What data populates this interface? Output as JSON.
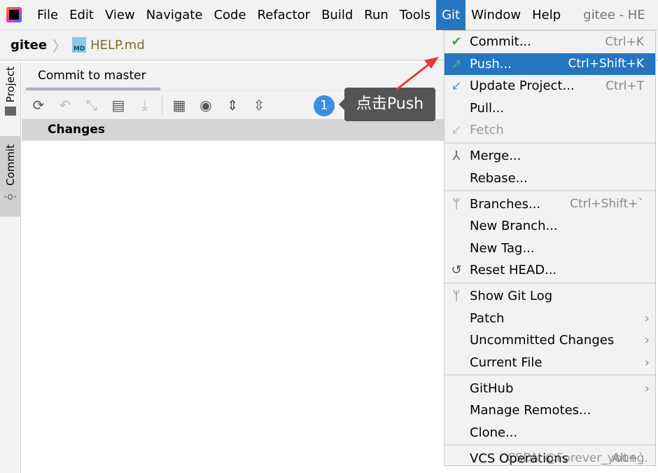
{
  "menubar": {
    "items": [
      "File",
      "Edit",
      "View",
      "Navigate",
      "Code",
      "Refactor",
      "Build",
      "Run",
      "Tools",
      "Git",
      "Window",
      "Help"
    ],
    "active": "Git",
    "title": "gitee - HE"
  },
  "breadcrumb": {
    "project": "gitee",
    "file": "HELP.md",
    "file_icon_label": "MD"
  },
  "left_strip": {
    "tabs": [
      "Project",
      "Commit"
    ]
  },
  "tool_window": {
    "tab": "Commit to master",
    "changes_header": "Changes",
    "toolbar": [
      "refresh-icon",
      "rollback-icon",
      "shelve-icon",
      "diff-icon",
      "unshelve-icon",
      "group-by-icon",
      "view-options-icon",
      "expand-all-icon",
      "collapse-all-icon"
    ]
  },
  "annotation": {
    "number": "1",
    "text": "点击Push",
    "arrow_color": "#e53935"
  },
  "git_menu": {
    "groups": [
      [
        {
          "label": "Commit...",
          "shortcut": "Ctrl+K",
          "icon": "check-icon"
        },
        {
          "label": "Push...",
          "shortcut": "Ctrl+Shift+K",
          "icon": "push-arrow-icon",
          "selected": true
        },
        {
          "label": "Update Project...",
          "shortcut": "Ctrl+T",
          "icon": "update-arrow-icon"
        },
        {
          "label": "Pull..."
        },
        {
          "label": "Fetch",
          "icon": "fetch-icon",
          "disabled": true
        }
      ],
      [
        {
          "label": "Merge...",
          "icon": "merge-icon"
        },
        {
          "label": "Rebase..."
        }
      ],
      [
        {
          "label": "Branches...",
          "shortcut": "Ctrl+Shift+`",
          "icon": "branch-icon"
        },
        {
          "label": "New Branch..."
        },
        {
          "label": "New Tag..."
        },
        {
          "label": "Reset HEAD...",
          "icon": "reset-icon"
        }
      ],
      [
        {
          "label": "Show Git Log",
          "icon": "git-log-icon"
        },
        {
          "label": "Patch",
          "submenu": true
        },
        {
          "label": "Uncommitted Changes",
          "submenu": true
        },
        {
          "label": "Current File",
          "submenu": true
        }
      ],
      [
        {
          "label": "GitHub",
          "submenu": true
        },
        {
          "label": "Manage Remotes..."
        },
        {
          "label": "Clone..."
        }
      ],
      [
        {
          "label": "VCS Operations",
          "shortcut": "Alt+`"
        }
      ]
    ]
  },
  "watermark": "CSDN @Forever_young."
}
